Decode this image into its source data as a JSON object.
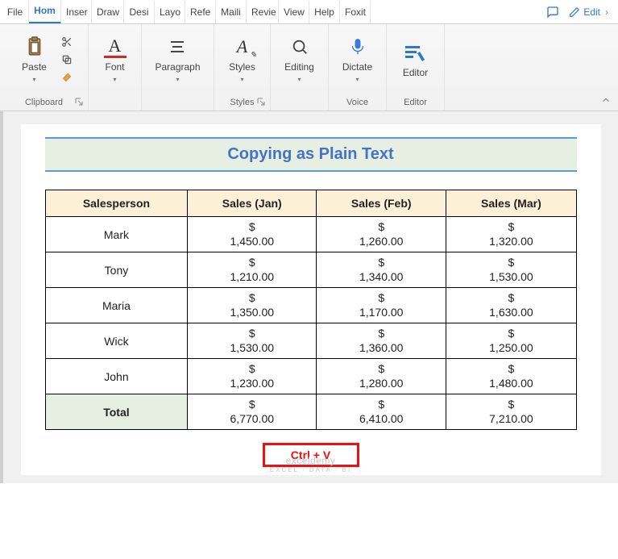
{
  "tabs": {
    "items": [
      "File",
      "Hom",
      "Inser",
      "Draw",
      "Desi",
      "Layo",
      "Refe",
      "Maili",
      "Revie",
      "View",
      "Help",
      "Foxit"
    ],
    "active_index": 1,
    "edit_label": "Edit"
  },
  "ribbon": {
    "paste_label": "Paste",
    "font_label": "Font",
    "paragraph_label": "Paragraph",
    "styles_label": "Styles",
    "editing_label": "Editing",
    "dictate_label": "Dictate",
    "editor_label": "Editor",
    "group_clipboard": "Clipboard",
    "group_styles": "Styles",
    "group_voice": "Voice",
    "group_editor": "Editor"
  },
  "document": {
    "title": "Copying as Plain Text",
    "headers": [
      "Salesperson",
      "Sales (Jan)",
      "Sales (Feb)",
      "Sales (Mar)"
    ],
    "rows": [
      {
        "name": "Mark",
        "jan": "1,450.00",
        "feb": "1,260.00",
        "mar": "1,320.00"
      },
      {
        "name": "Tony",
        "jan": "1,210.00",
        "feb": "1,340.00",
        "mar": "1,530.00"
      },
      {
        "name": "Maria",
        "jan": "1,350.00",
        "feb": "1,170.00",
        "mar": "1,630.00"
      },
      {
        "name": "Wick",
        "jan": "1,530.00",
        "feb": "1,360.00",
        "mar": "1,250.00"
      },
      {
        "name": "John",
        "jan": "1,230.00",
        "feb": "1,280.00",
        "mar": "1,480.00"
      }
    ],
    "total_label": "Total",
    "totals": {
      "jan": "6,770.00",
      "feb": "6,410.00",
      "mar": "7,210.00"
    },
    "currency": "$",
    "key_hint": "Ctrl + V",
    "watermark_main": "exceldemy",
    "watermark_sub": "EXCEL · DATA · BI"
  }
}
